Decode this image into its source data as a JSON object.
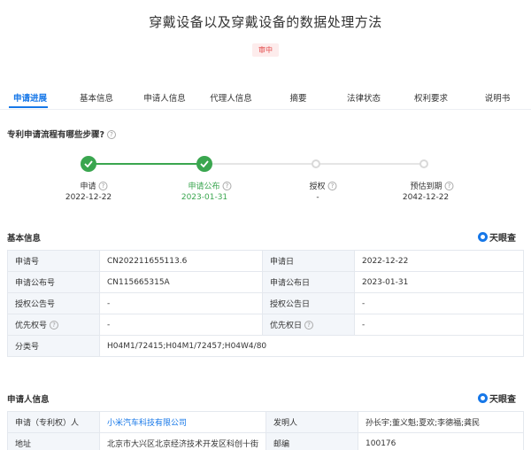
{
  "header": {
    "title": "穿戴设备以及穿戴设备的数据处理方法",
    "status_badge": "审中"
  },
  "tabs": [
    {
      "label": "申请进展",
      "active": true
    },
    {
      "label": "基本信息",
      "active": false
    },
    {
      "label": "申请人信息",
      "active": false
    },
    {
      "label": "代理人信息",
      "active": false
    },
    {
      "label": "摘要",
      "active": false
    },
    {
      "label": "法律状态",
      "active": false
    },
    {
      "label": "权利要求",
      "active": false
    },
    {
      "label": "说明书",
      "active": false
    }
  ],
  "process": {
    "question": "专利申请流程有哪些步骤?",
    "steps": [
      {
        "label": "申请",
        "date": "2022-12-22",
        "done": true
      },
      {
        "label": "申请公布",
        "date": "2023-01-31",
        "done": true
      },
      {
        "label": "授权",
        "date": "-",
        "done": false
      },
      {
        "label": "预估到期",
        "date": "2042-12-22",
        "done": false
      }
    ]
  },
  "basic_info": {
    "title": "基本信息",
    "brand": "天眼查",
    "rows": [
      [
        "申请号",
        "CN202211655113.6",
        "申请日",
        "2022-12-22"
      ],
      [
        "申请公布号",
        "CN115665315A",
        "申请公布日",
        "2023-01-31"
      ],
      [
        "授权公告号",
        "-",
        "授权公告日",
        "-"
      ],
      [
        "优先权号",
        "-",
        "优先权日",
        "-"
      ]
    ],
    "class_label": "分类号",
    "class_value": "H04M1/72415;H04M1/72457;H04W4/80"
  },
  "applicant_info": {
    "title": "申请人信息",
    "brand": "天眼查",
    "row1": [
      "申请（专利权）人",
      "小米汽车科技有限公司",
      "发明人",
      "孙长宇;董义魁;夏欢;李德福;龚民"
    ],
    "row2": [
      "地址",
      "北京市大兴区北京经济技术开发区科创十街",
      "邮编",
      "100176"
    ]
  },
  "colors": {
    "accent": "#1677e8",
    "success": "#3aa64f",
    "badge": "#e34848"
  }
}
